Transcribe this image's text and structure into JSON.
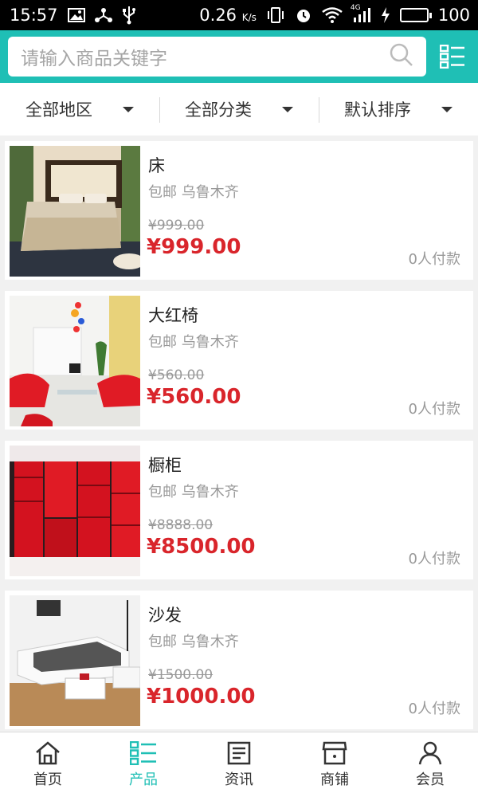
{
  "status_bar": {
    "time": "15:57",
    "speed": "0.26",
    "speed_unit": "K/s",
    "network": "4G",
    "battery": "100",
    "icons": [
      "image-icon",
      "share-icon",
      "usb-icon",
      "vibrate-icon",
      "alarm-icon",
      "wifi-icon",
      "signal-icon",
      "charging-icon",
      "battery-icon"
    ]
  },
  "search": {
    "placeholder": "请输入商品关键字"
  },
  "filters": [
    {
      "label": "全部地区"
    },
    {
      "label": "全部分类"
    },
    {
      "label": "默认排序"
    }
  ],
  "products": [
    {
      "title": "床",
      "shipping": "包邮 乌鲁木齐",
      "old_price": "¥999.00",
      "price": "¥999.00",
      "paid": "0人付款"
    },
    {
      "title": "大红椅",
      "shipping": "包邮 乌鲁木齐",
      "old_price": "¥560.00",
      "price": "¥560.00",
      "paid": "0人付款"
    },
    {
      "title": "橱柜",
      "shipping": "包邮 乌鲁木齐",
      "old_price": "¥8888.00",
      "price": "¥8500.00",
      "paid": "0人付款"
    },
    {
      "title": "沙发",
      "shipping": "包邮 乌鲁木齐",
      "old_price": "¥1500.00",
      "price": "¥1000.00",
      "paid": "0人付款"
    }
  ],
  "nav": [
    {
      "label": "首页",
      "icon": "home-icon"
    },
    {
      "label": "产品",
      "icon": "list-icon",
      "active": true
    },
    {
      "label": "资讯",
      "icon": "news-icon"
    },
    {
      "label": "商铺",
      "icon": "store-icon"
    },
    {
      "label": "会员",
      "icon": "user-icon"
    }
  ],
  "colors": {
    "accent": "#1fbfb5",
    "price_red": "#d9252b"
  }
}
